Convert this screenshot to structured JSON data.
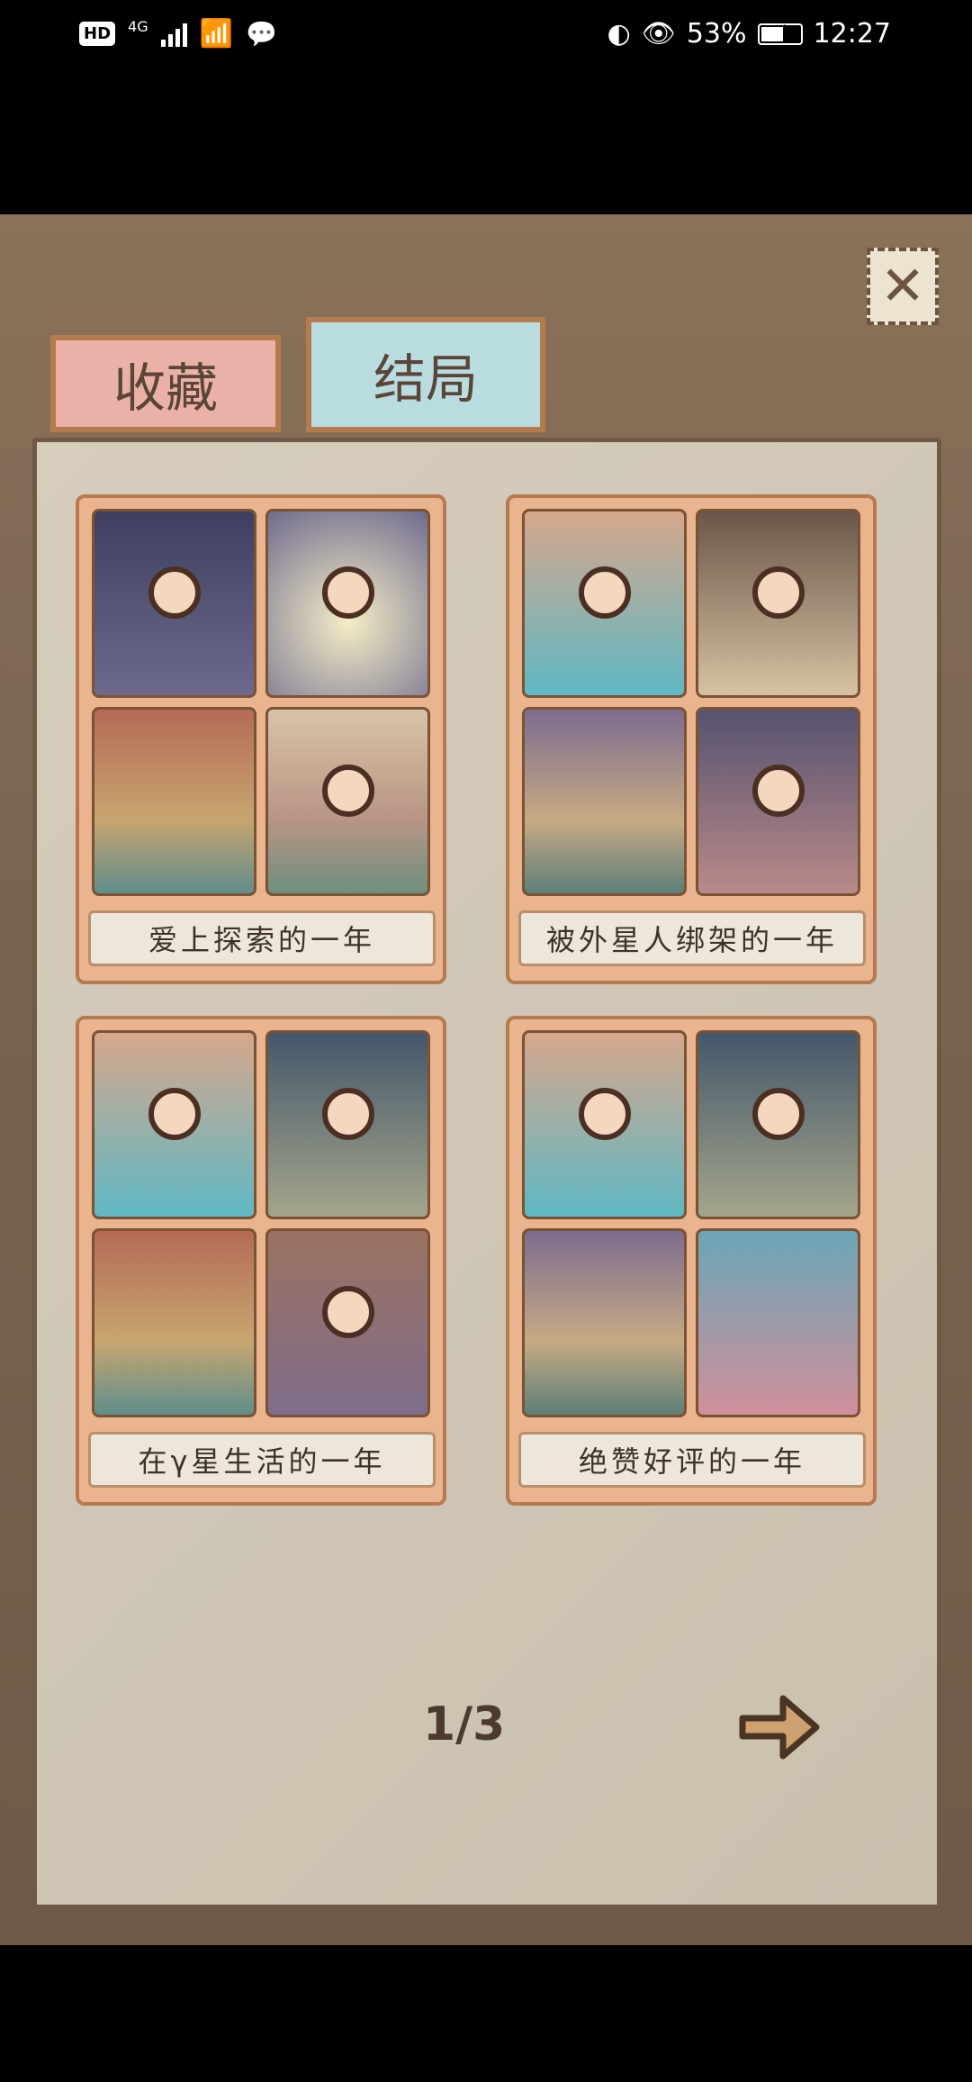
{
  "status": {
    "hd": "HD",
    "network": "4G",
    "right_text": "53%",
    "time": "12:27"
  },
  "icons": {
    "close": "close-icon",
    "next": "arrow-right-icon"
  },
  "tabs": [
    {
      "label": "收藏"
    },
    {
      "label": "结局"
    }
  ],
  "endings": [
    {
      "title": "爱上探索的一年"
    },
    {
      "title": "被外星人绑架的一年"
    },
    {
      "title": "在γ星生活的一年"
    },
    {
      "title": "绝赞好评的一年"
    }
  ],
  "pagination": {
    "text": "1/3"
  }
}
